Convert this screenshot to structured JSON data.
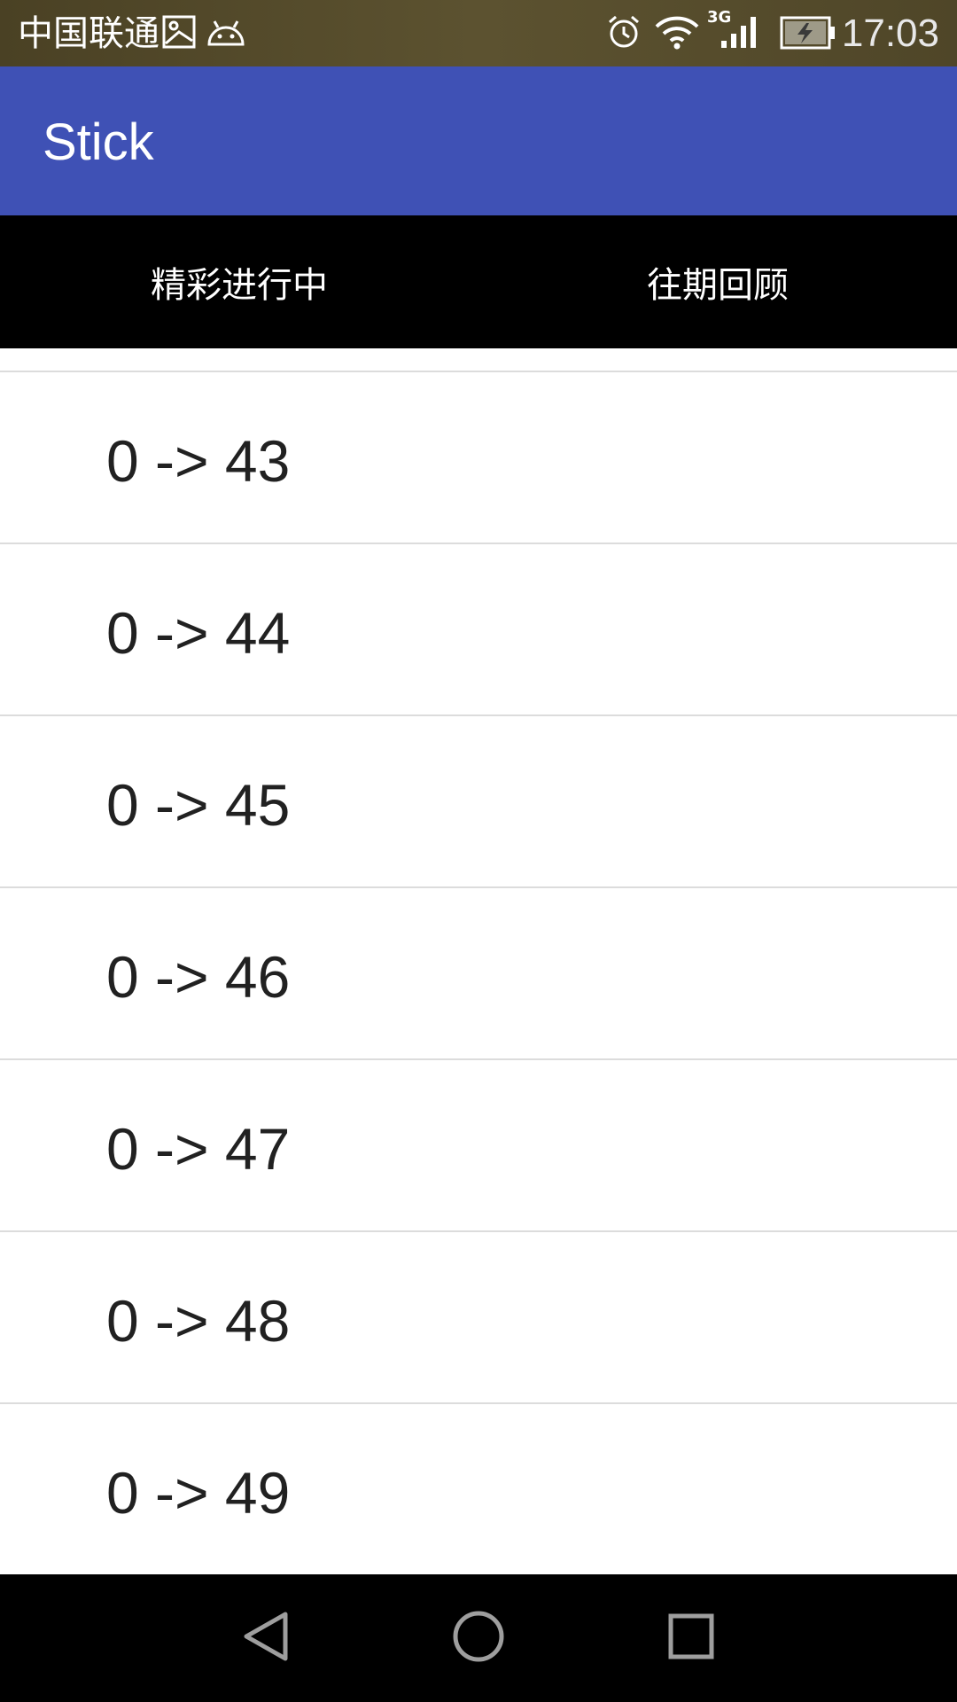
{
  "status_bar": {
    "carrier": "中国联通",
    "network_type": "3G",
    "time": "17:03",
    "icons": [
      "image-icon",
      "android-icon",
      "alarm-icon",
      "wifi-icon",
      "signal-icon",
      "battery-charging-icon"
    ]
  },
  "app_bar": {
    "title": "Stick",
    "background_color": "#3f51b5"
  },
  "tabs": [
    {
      "label": "精彩进行中"
    },
    {
      "label": "往期回顾"
    }
  ],
  "list": {
    "items": [
      {
        "label": "0 -> 43"
      },
      {
        "label": "0 -> 44"
      },
      {
        "label": "0 -> 45"
      },
      {
        "label": "0 -> 46"
      },
      {
        "label": "0 -> 47"
      },
      {
        "label": "0 -> 48"
      },
      {
        "label": "0 -> 49"
      }
    ]
  },
  "nav_bar": {
    "buttons": [
      "back-icon",
      "home-icon",
      "recents-icon"
    ]
  }
}
